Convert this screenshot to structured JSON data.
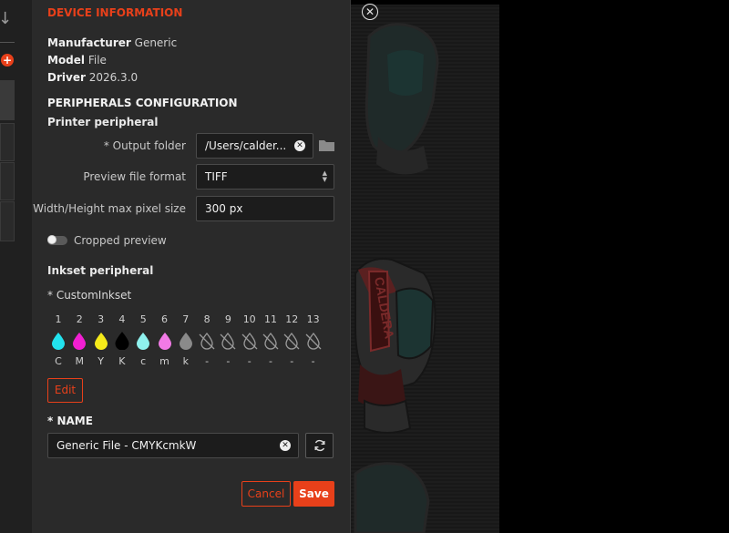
{
  "device": {
    "title": "DEVICE INFORMATION",
    "manufacturer_label": "Manufacturer",
    "manufacturer": "Generic",
    "model_label": "Model",
    "model": "File",
    "driver_label": "Driver",
    "driver": "2026.3.0"
  },
  "peripherals": {
    "title": "PERIPHERALS CONFIGURATION",
    "printer": {
      "title": "Printer peripheral",
      "output_folder_label": "* Output folder",
      "output_folder_value": "/Users/calder...",
      "preview_format_label": "Preview file format",
      "preview_format_value": "TIFF",
      "max_size_label": "Width/Height max pixel size",
      "max_size_value": "300 px",
      "cropped_label": "Cropped preview",
      "cropped_on": false
    },
    "inkset": {
      "title": "Inkset peripheral",
      "name": "* CustomInkset",
      "channels": [
        {
          "num": "1",
          "label": "C",
          "color": "#22e3ee",
          "active": true
        },
        {
          "num": "2",
          "label": "M",
          "color": "#f21fd2",
          "active": true
        },
        {
          "num": "3",
          "label": "Y",
          "color": "#f5ea1a",
          "active": true
        },
        {
          "num": "4",
          "label": "K",
          "color": "#000000",
          "active": true
        },
        {
          "num": "5",
          "label": "c",
          "color": "#8ff1ee",
          "active": true
        },
        {
          "num": "6",
          "label": "m",
          "color": "#f27ae6",
          "active": true
        },
        {
          "num": "7",
          "label": "k",
          "color": "#8a8a8a",
          "active": true
        },
        {
          "num": "8",
          "label": "-",
          "color": "",
          "active": false
        },
        {
          "num": "9",
          "label": "-",
          "color": "",
          "active": false
        },
        {
          "num": "10",
          "label": "-",
          "color": "",
          "active": false
        },
        {
          "num": "11",
          "label": "-",
          "color": "",
          "active": false
        },
        {
          "num": "12",
          "label": "-",
          "color": "",
          "active": false
        },
        {
          "num": "13",
          "label": "-",
          "color": "",
          "active": false
        }
      ],
      "edit_label": "Edit"
    }
  },
  "name_section": {
    "title": "* NAME",
    "value": "Generic File - CMYKcmkW"
  },
  "actions": {
    "cancel": "Cancel",
    "save": "Save"
  },
  "colors": {
    "accent": "#e8401a"
  }
}
